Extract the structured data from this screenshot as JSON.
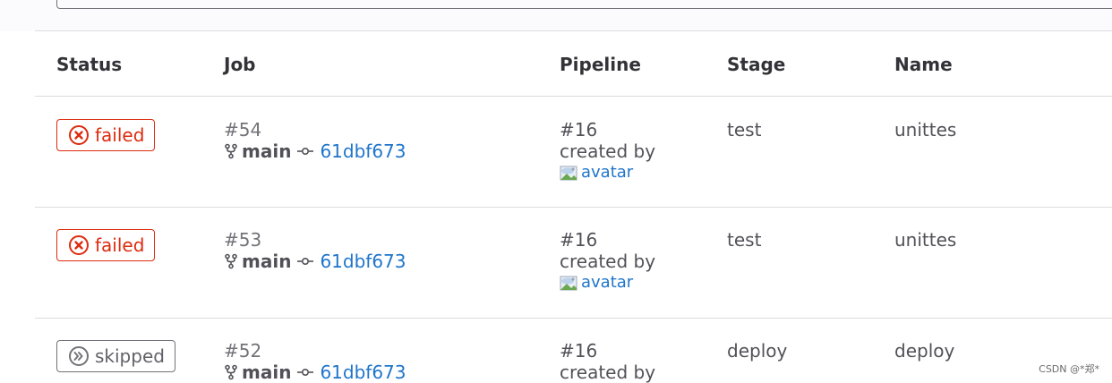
{
  "table": {
    "headers": {
      "status": "Status",
      "job": "Job",
      "pipeline": "Pipeline",
      "stage": "Stage",
      "name": "Name"
    },
    "rows": [
      {
        "status": "failed",
        "job_id": "#54",
        "branch": "main",
        "commit": "61dbf673",
        "pipeline_id": "#16",
        "created_by": "created by",
        "avatar_alt": "avatar",
        "stage": "test",
        "name": "unittes"
      },
      {
        "status": "failed",
        "job_id": "#53",
        "branch": "main",
        "commit": "61dbf673",
        "pipeline_id": "#16",
        "created_by": "created by",
        "avatar_alt": "avatar",
        "stage": "test",
        "name": "unittes"
      },
      {
        "status": "skipped",
        "job_id": "#52",
        "branch": "main",
        "commit": "61dbf673",
        "pipeline_id": "#16",
        "created_by": "created by",
        "stage": "deploy",
        "name": "deploy"
      }
    ]
  },
  "watermark": "CSDN @*郑*",
  "colors": {
    "failed": "#dd2b0e",
    "skipped": "#737278",
    "link": "#1f75cb"
  },
  "icons": {
    "failed": "status-failed-icon",
    "skipped": "status-skipped-icon",
    "branch": "branch-icon",
    "commit": "commit-icon"
  }
}
